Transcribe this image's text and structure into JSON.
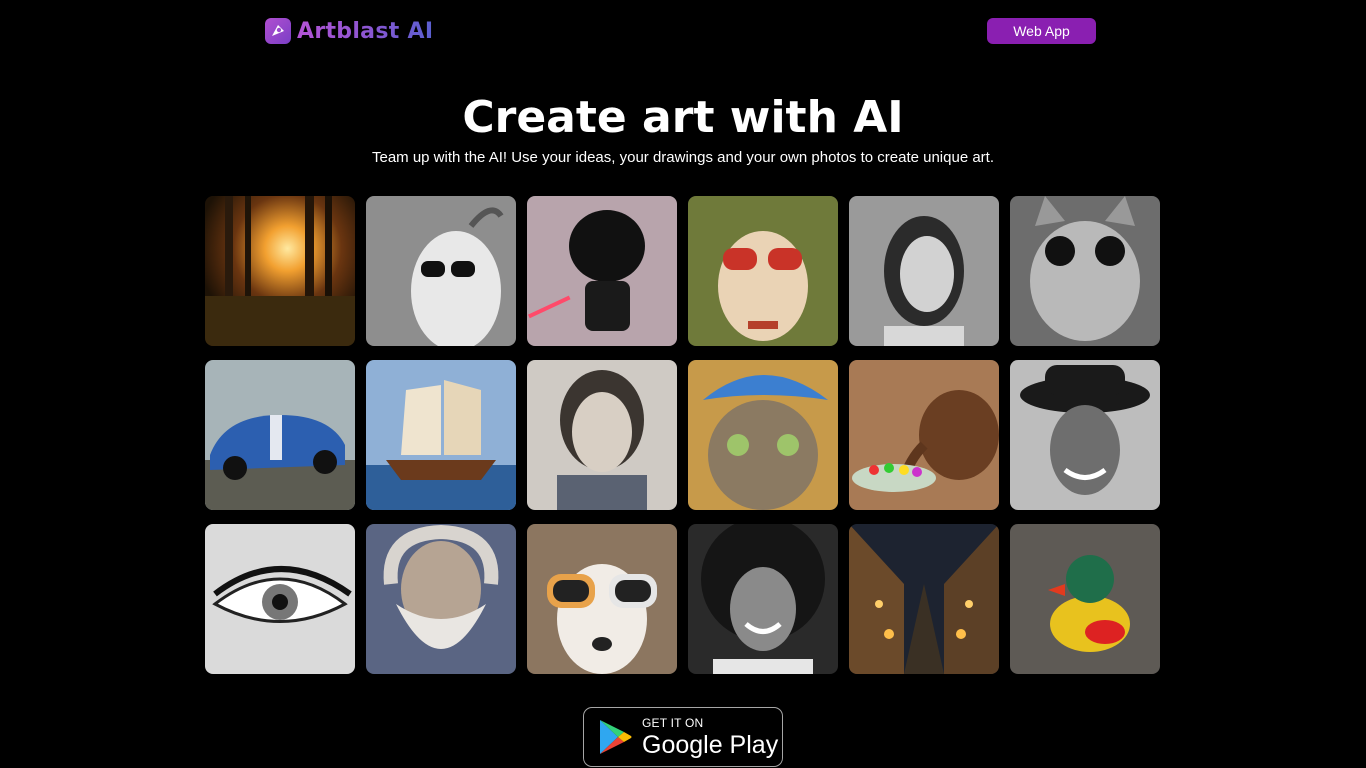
{
  "header": {
    "logo_text": "Artblast AI",
    "logo_icon": "artblast-logo-icon",
    "web_app_label": "Web App",
    "accent_color": "#8a1fb1"
  },
  "hero": {
    "title": "Create art with AI",
    "subtitle": "Team up with the AI! Use your ideas, your drawings and your own photos to create unique art."
  },
  "gallery": {
    "items": [
      {
        "subject": "forest-sunset"
      },
      {
        "subject": "goat-with-sunglasses"
      },
      {
        "subject": "darth-vader-figure"
      },
      {
        "subject": "dog-with-red-sunglasses"
      },
      {
        "subject": "woman-portrait-bw"
      },
      {
        "subject": "cat-with-sunglasses-bw"
      },
      {
        "subject": "blue-sports-car"
      },
      {
        "subject": "sailing-ship"
      },
      {
        "subject": "painted-girl-portrait"
      },
      {
        "subject": "cat-with-blue-hat"
      },
      {
        "subject": "wooden-elephant-with-candy"
      },
      {
        "subject": "smiling-woman-with-hat-bw"
      },
      {
        "subject": "eye-closeup-bw"
      },
      {
        "subject": "old-wizard-portrait"
      },
      {
        "subject": "dog-with-white-sunglasses"
      },
      {
        "subject": "smiling-woman-bw"
      },
      {
        "subject": "night-street"
      },
      {
        "subject": "rubber-duck"
      }
    ]
  },
  "store_badge": {
    "small_text": "GET IT ON",
    "big_text": "Google Play",
    "icon": "google-play-icon"
  }
}
